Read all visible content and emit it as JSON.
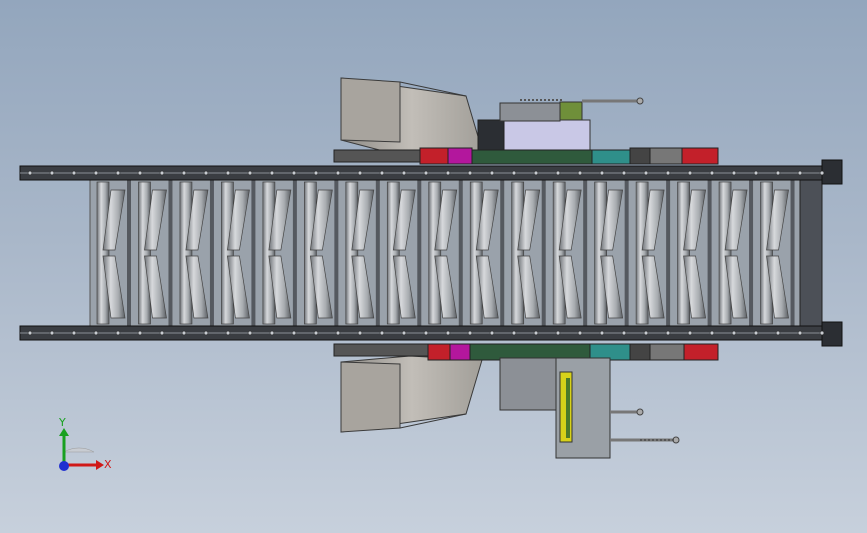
{
  "viewport": {
    "background_top": "#93a6bd",
    "background_bottom": "#c7d0dc"
  },
  "model": {
    "roller_count": 17,
    "colors": {
      "frame": "#3a3d42",
      "frame_light": "#8a8f96",
      "roller": "#b9bcc0",
      "roller_dark": "#6f7378",
      "hopper": "#b4b1ab",
      "red_block": "#c3202a",
      "magenta_block": "#b3179d",
      "green_block": "#2f5a3c",
      "teal_block": "#2f8f8a",
      "yellow_part": "#d7d21a",
      "lavender_box": "#c9c8e6"
    }
  },
  "triad": {
    "x_label": "X",
    "y_label": "Y",
    "x_color": "#d01818",
    "y_color": "#18a020",
    "z_color": "#2030d0"
  }
}
